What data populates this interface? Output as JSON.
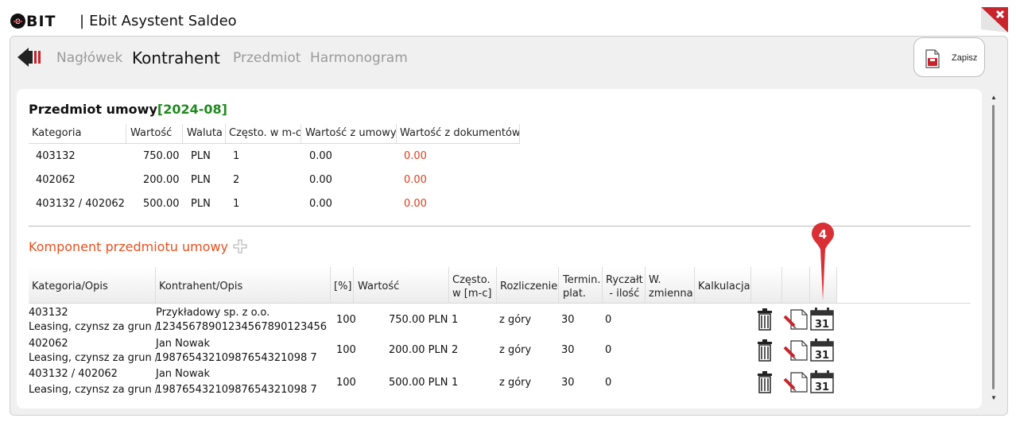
{
  "app": {
    "brand": "BIT",
    "brand_e": "e",
    "separator": "|",
    "title": "Ebit Asystent Saldeo"
  },
  "tabs": [
    {
      "label": "Nagłówek",
      "active": false
    },
    {
      "label": "Kontrahent",
      "active": true
    },
    {
      "label": "Przedmiot",
      "active": false
    },
    {
      "label": "Harmonogram",
      "active": false
    }
  ],
  "toolbar": {
    "save_label": "Zapisz"
  },
  "contract": {
    "title": "Przedmiot umowy",
    "period": "[2024-08]",
    "columns": [
      "Kategoria",
      "Wartość",
      "Waluta",
      "Często. w m-c",
      "Wartość z umowy",
      "Wartość z dokumentów"
    ],
    "rows": [
      {
        "kategoria": "403132",
        "wartosc": "750.00",
        "waluta": "PLN",
        "czesto": "1",
        "z_umowy": "0.00",
        "z_dokumentow": "0.00"
      },
      {
        "kategoria": "402062",
        "wartosc": "200.00",
        "waluta": "PLN",
        "czesto": "2",
        "z_umowy": "0.00",
        "z_dokumentow": "0.00"
      },
      {
        "kategoria": "403132 / 402062",
        "wartosc": "500.00",
        "waluta": "PLN",
        "czesto": "1",
        "z_umowy": "0.00",
        "z_dokumentow": "0.00"
      }
    ]
  },
  "components": {
    "title": "Komponent przedmiotu umowy",
    "columns": {
      "kategoria": "Kategoria/Opis",
      "kontrahent": "Kontrahent/Opis",
      "procent": "[%]",
      "wartosc": "Wartość",
      "czesto_1": "Często.",
      "czesto_2": "w [m-c]",
      "rozliczenie": "Rozliczenie",
      "termin_1": "Termin.",
      "termin_2": "plat.",
      "ryczalt_1": "Ryczałt",
      "ryczalt_2": "- ilość",
      "zmienna_1": "W.",
      "zmienna_2": "zmienna",
      "kalkulacja": "Kalkulacja"
    },
    "rows": [
      {
        "kategoria": "403132",
        "opis": "Leasing, czynsz za grun /",
        "kontrahent": "Przykładowy sp. z o.o.",
        "konto": "12345678901234567890123456",
        "procent": "100",
        "wartosc": "750.00 PLN",
        "czesto": "1",
        "rozliczenie": "z góry",
        "termin": "30",
        "ryczalt": "0"
      },
      {
        "kategoria": "402062",
        "opis": "Leasing, czynsz za grun /",
        "kontrahent": "Jan Nowak",
        "konto": "19876543210987654321098 7",
        "procent": "100",
        "wartosc": "200.00 PLN",
        "czesto": "2",
        "rozliczenie": "z góry",
        "termin": "30",
        "ryczalt": "0"
      },
      {
        "kategoria": "403132 / 402062",
        "opis": "Leasing, czynsz za grun /",
        "kontrahent": "Jan Nowak",
        "konto": "19876543210987654321098 7",
        "procent": "100",
        "wartosc": "500.00 PLN",
        "czesto": "1",
        "rozliczenie": "z góry",
        "termin": "30",
        "ryczalt": "0"
      }
    ]
  },
  "annotation": {
    "badge": "4"
  },
  "icons": {
    "calendar_day": "31"
  },
  "colors": {
    "accent": "#e8501e",
    "period": "#1f8a1f",
    "red_value": "#e23b1a",
    "badge": "#d93036"
  }
}
